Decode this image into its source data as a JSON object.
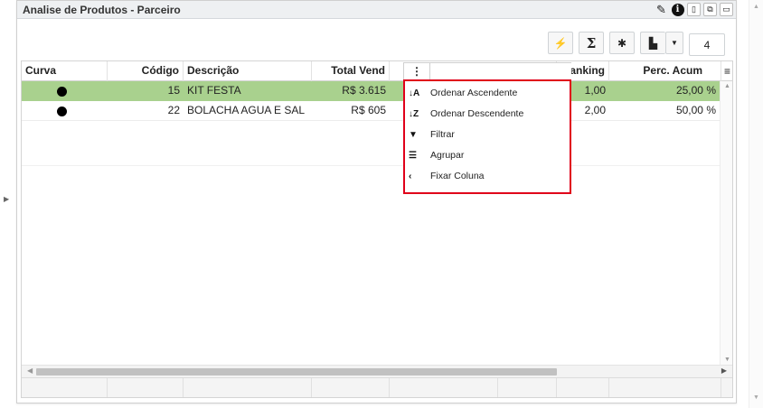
{
  "panel": {
    "title": "Analise de Produtos - Parceiro",
    "header_buttons": [
      {
        "name": "pencil-icon",
        "glyph": "✎"
      },
      {
        "name": "info-icon",
        "glyph": "i"
      },
      {
        "name": "sidebar-toggle-icon",
        "glyph": "▯"
      },
      {
        "name": "restore-icon",
        "glyph": "⧉"
      },
      {
        "name": "maximize-icon",
        "glyph": "▭"
      }
    ]
  },
  "toolbar": {
    "lightning_glyph": "⚡",
    "sigma_glyph": "Σ",
    "gear_glyph": "✱",
    "export_glyph": "▙",
    "dropdown_glyph": "▼",
    "count_value": "4"
  },
  "grid": {
    "columns": [
      {
        "label": "Curva"
      },
      {
        "label": "Código"
      },
      {
        "label": "Descrição"
      },
      {
        "label": "Total Vend"
      },
      {
        "label": "Ranking"
      },
      {
        "label": "Perc. Acum"
      }
    ],
    "menu_glyph": "≡",
    "rows": [
      {
        "codigo": "15",
        "descricao": "KIT FESTA",
        "total": "R$ 3.615",
        "ranking": "1,00",
        "perc": "25,00 %"
      },
      {
        "codigo": "22",
        "descricao": "BOLACHA AGUA E SAL",
        "total": "R$ 605",
        "ranking": "2,00",
        "perc": "50,00 %"
      }
    ]
  },
  "column_menu": {
    "trigger_glyph": "⋮",
    "items": [
      {
        "icon": "sort-ascending-icon",
        "glyph": "↓A",
        "label": "Ordenar Ascendente"
      },
      {
        "icon": "sort-descending-icon",
        "glyph": "↓Z",
        "label": "Ordenar Descendente"
      },
      {
        "icon": "filter-icon",
        "glyph": "▼",
        "label": "Filtrar"
      },
      {
        "icon": "group-icon",
        "glyph": "☰",
        "label": "Agrupar"
      },
      {
        "icon": "chevron-left-icon",
        "glyph": "‹",
        "label": "Fixar Coluna"
      }
    ]
  },
  "colors": {
    "selected_row": "#a9d18e",
    "popup_border": "#e0001a"
  }
}
